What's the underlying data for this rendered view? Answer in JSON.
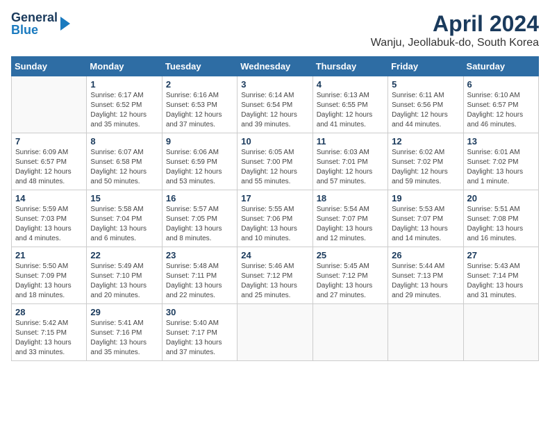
{
  "header": {
    "logo": {
      "line1": "General",
      "line2": "Blue"
    },
    "title": "April 2024",
    "subtitle": "Wanju, Jeollabuk-do, South Korea"
  },
  "calendar": {
    "days_of_week": [
      "Sunday",
      "Monday",
      "Tuesday",
      "Wednesday",
      "Thursday",
      "Friday",
      "Saturday"
    ],
    "weeks": [
      [
        {
          "day": "",
          "info": ""
        },
        {
          "day": "1",
          "info": "Sunrise: 6:17 AM\nSunset: 6:52 PM\nDaylight: 12 hours\nand 35 minutes."
        },
        {
          "day": "2",
          "info": "Sunrise: 6:16 AM\nSunset: 6:53 PM\nDaylight: 12 hours\nand 37 minutes."
        },
        {
          "day": "3",
          "info": "Sunrise: 6:14 AM\nSunset: 6:54 PM\nDaylight: 12 hours\nand 39 minutes."
        },
        {
          "day": "4",
          "info": "Sunrise: 6:13 AM\nSunset: 6:55 PM\nDaylight: 12 hours\nand 41 minutes."
        },
        {
          "day": "5",
          "info": "Sunrise: 6:11 AM\nSunset: 6:56 PM\nDaylight: 12 hours\nand 44 minutes."
        },
        {
          "day": "6",
          "info": "Sunrise: 6:10 AM\nSunset: 6:57 PM\nDaylight: 12 hours\nand 46 minutes."
        }
      ],
      [
        {
          "day": "7",
          "info": "Sunrise: 6:09 AM\nSunset: 6:57 PM\nDaylight: 12 hours\nand 48 minutes."
        },
        {
          "day": "8",
          "info": "Sunrise: 6:07 AM\nSunset: 6:58 PM\nDaylight: 12 hours\nand 50 minutes."
        },
        {
          "day": "9",
          "info": "Sunrise: 6:06 AM\nSunset: 6:59 PM\nDaylight: 12 hours\nand 53 minutes."
        },
        {
          "day": "10",
          "info": "Sunrise: 6:05 AM\nSunset: 7:00 PM\nDaylight: 12 hours\nand 55 minutes."
        },
        {
          "day": "11",
          "info": "Sunrise: 6:03 AM\nSunset: 7:01 PM\nDaylight: 12 hours\nand 57 minutes."
        },
        {
          "day": "12",
          "info": "Sunrise: 6:02 AM\nSunset: 7:02 PM\nDaylight: 12 hours\nand 59 minutes."
        },
        {
          "day": "13",
          "info": "Sunrise: 6:01 AM\nSunset: 7:02 PM\nDaylight: 13 hours\nand 1 minute."
        }
      ],
      [
        {
          "day": "14",
          "info": "Sunrise: 5:59 AM\nSunset: 7:03 PM\nDaylight: 13 hours\nand 4 minutes."
        },
        {
          "day": "15",
          "info": "Sunrise: 5:58 AM\nSunset: 7:04 PM\nDaylight: 13 hours\nand 6 minutes."
        },
        {
          "day": "16",
          "info": "Sunrise: 5:57 AM\nSunset: 7:05 PM\nDaylight: 13 hours\nand 8 minutes."
        },
        {
          "day": "17",
          "info": "Sunrise: 5:55 AM\nSunset: 7:06 PM\nDaylight: 13 hours\nand 10 minutes."
        },
        {
          "day": "18",
          "info": "Sunrise: 5:54 AM\nSunset: 7:07 PM\nDaylight: 13 hours\nand 12 minutes."
        },
        {
          "day": "19",
          "info": "Sunrise: 5:53 AM\nSunset: 7:07 PM\nDaylight: 13 hours\nand 14 minutes."
        },
        {
          "day": "20",
          "info": "Sunrise: 5:51 AM\nSunset: 7:08 PM\nDaylight: 13 hours\nand 16 minutes."
        }
      ],
      [
        {
          "day": "21",
          "info": "Sunrise: 5:50 AM\nSunset: 7:09 PM\nDaylight: 13 hours\nand 18 minutes."
        },
        {
          "day": "22",
          "info": "Sunrise: 5:49 AM\nSunset: 7:10 PM\nDaylight: 13 hours\nand 20 minutes."
        },
        {
          "day": "23",
          "info": "Sunrise: 5:48 AM\nSunset: 7:11 PM\nDaylight: 13 hours\nand 22 minutes."
        },
        {
          "day": "24",
          "info": "Sunrise: 5:46 AM\nSunset: 7:12 PM\nDaylight: 13 hours\nand 25 minutes."
        },
        {
          "day": "25",
          "info": "Sunrise: 5:45 AM\nSunset: 7:12 PM\nDaylight: 13 hours\nand 27 minutes."
        },
        {
          "day": "26",
          "info": "Sunrise: 5:44 AM\nSunset: 7:13 PM\nDaylight: 13 hours\nand 29 minutes."
        },
        {
          "day": "27",
          "info": "Sunrise: 5:43 AM\nSunset: 7:14 PM\nDaylight: 13 hours\nand 31 minutes."
        }
      ],
      [
        {
          "day": "28",
          "info": "Sunrise: 5:42 AM\nSunset: 7:15 PM\nDaylight: 13 hours\nand 33 minutes."
        },
        {
          "day": "29",
          "info": "Sunrise: 5:41 AM\nSunset: 7:16 PM\nDaylight: 13 hours\nand 35 minutes."
        },
        {
          "day": "30",
          "info": "Sunrise: 5:40 AM\nSunset: 7:17 PM\nDaylight: 13 hours\nand 37 minutes."
        },
        {
          "day": "",
          "info": ""
        },
        {
          "day": "",
          "info": ""
        },
        {
          "day": "",
          "info": ""
        },
        {
          "day": "",
          "info": ""
        }
      ]
    ]
  }
}
